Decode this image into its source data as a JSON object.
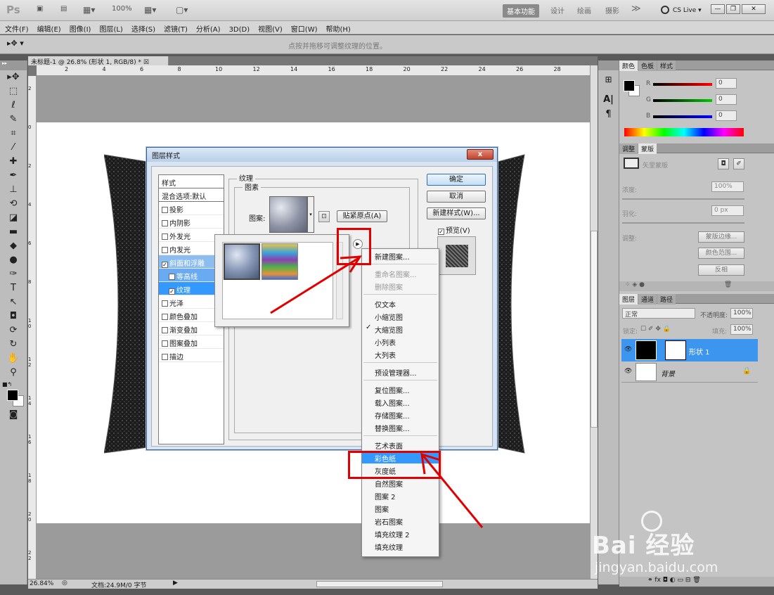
{
  "app": {
    "logo": "Ps",
    "zoom": "100%"
  },
  "workspaces": {
    "active": "基本功能",
    "items": [
      "设计",
      "绘画",
      "摄影"
    ],
    "more": "≫",
    "cslive": "CS Live"
  },
  "menu": [
    "文件(F)",
    "编辑(E)",
    "图像(I)",
    "图层(L)",
    "选择(S)",
    "滤镜(T)",
    "分析(A)",
    "3D(D)",
    "视图(V)",
    "窗口(W)",
    "帮助(H)"
  ],
  "options_hint": "点按并拖移可调整纹理的位置。",
  "doc": {
    "tab": "未标题-1 @ 26.8% (形状 1, RGB/8) *"
  },
  "ruler_top": [
    "2",
    "4",
    "6",
    "8",
    "10",
    "12",
    "14",
    "16",
    "18",
    "20",
    "22",
    "24",
    "26",
    "28"
  ],
  "ruler_left": [
    "2",
    "0",
    "2",
    "4",
    "6",
    "8",
    "1 0",
    "1 2",
    "1 4",
    "1 6",
    "1 8",
    "2 0",
    "2 2"
  ],
  "status": {
    "zoom": "26.84%",
    "docinfo": "文档:24.9M/0 字节"
  },
  "panel_color": {
    "tabs": [
      "颜色",
      "色板",
      "样式"
    ],
    "r": "R",
    "g": "G",
    "b": "B",
    "rv": "0",
    "gv": "0",
    "bv": "0"
  },
  "panel_masks": {
    "tabs": [
      "调整",
      "蒙版"
    ],
    "title": "矢里蒙版",
    "density_label": "浓度:",
    "density": "100%",
    "feather_label": "羽化:",
    "feather": "0 px",
    "refine_label": "调整:",
    "btn1": "蒙版边缘...",
    "btn2": "颜色范围...",
    "btn3": "反相"
  },
  "panel_layers": {
    "tabs": [
      "图层",
      "通道",
      "路径"
    ],
    "blend": "正常",
    "opacity_label": "不透明度:",
    "opacity": "100%",
    "lock_label": "锁定:",
    "fill_label": "填充:",
    "fill": "100%",
    "layer1": "形状 1",
    "layer2": "背景"
  },
  "dialog": {
    "title": "图层样式",
    "close": "x",
    "styles": [
      {
        "label": "样式",
        "type": "head"
      },
      {
        "label": "混合选项:默认",
        "type": "head"
      },
      {
        "label": "投影",
        "checked": false
      },
      {
        "label": "内阴影",
        "checked": false
      },
      {
        "label": "外发光",
        "checked": false
      },
      {
        "label": "内发光",
        "checked": false
      },
      {
        "label": "斜面和浮雕",
        "checked": true
      },
      {
        "label": "等高线",
        "checked": false,
        "sub": true
      },
      {
        "label": "纹理",
        "checked": true,
        "sub": true
      },
      {
        "label": "光泽",
        "checked": false
      },
      {
        "label": "颜色叠加",
        "checked": false
      },
      {
        "label": "渐变叠加",
        "checked": false
      },
      {
        "label": "图案叠加",
        "checked": false
      },
      {
        "label": "描边",
        "checked": false
      }
    ],
    "group": "纹理",
    "subgroup": "图素",
    "pattern_label": "图案:",
    "snap_btn": "贴紧原点(A)",
    "ok": "确定",
    "cancel": "取消",
    "newstyle": "新建样式(W)...",
    "preview": "预览(V)"
  },
  "context_menu": [
    {
      "label": "新建图案...",
      "type": "item"
    },
    {
      "type": "sep"
    },
    {
      "label": "重命名图案...",
      "type": "dis"
    },
    {
      "label": "删除图案",
      "type": "dis"
    },
    {
      "type": "sep"
    },
    {
      "label": "仅文本",
      "type": "item"
    },
    {
      "label": "小缩览图",
      "type": "item"
    },
    {
      "label": "大缩览图",
      "type": "check"
    },
    {
      "label": "小列表",
      "type": "item"
    },
    {
      "label": "大列表",
      "type": "item"
    },
    {
      "type": "sep"
    },
    {
      "label": "预设管理器...",
      "type": "item"
    },
    {
      "type": "sep"
    },
    {
      "label": "复位图案...",
      "type": "item"
    },
    {
      "label": "载入图案...",
      "type": "item"
    },
    {
      "label": "存储图案...",
      "type": "item"
    },
    {
      "label": "替换图案...",
      "type": "item"
    },
    {
      "type": "sep"
    },
    {
      "label": "艺术表面",
      "type": "item"
    },
    {
      "label": "彩色纸",
      "type": "hl"
    },
    {
      "label": "灰度纸",
      "type": "item"
    },
    {
      "label": "自然图案",
      "type": "item"
    },
    {
      "label": "图案 2",
      "type": "item"
    },
    {
      "label": "图案",
      "type": "item"
    },
    {
      "label": "岩石图案",
      "type": "item"
    },
    {
      "label": "填充纹理 2",
      "type": "item"
    },
    {
      "label": "填充纹理",
      "type": "item"
    }
  ],
  "watermark": {
    "brand": "Bai 经验",
    "url": "jingyan.baidu.com"
  },
  "colors": {
    "highlight": "#e00000",
    "selection": "#3399ff"
  }
}
